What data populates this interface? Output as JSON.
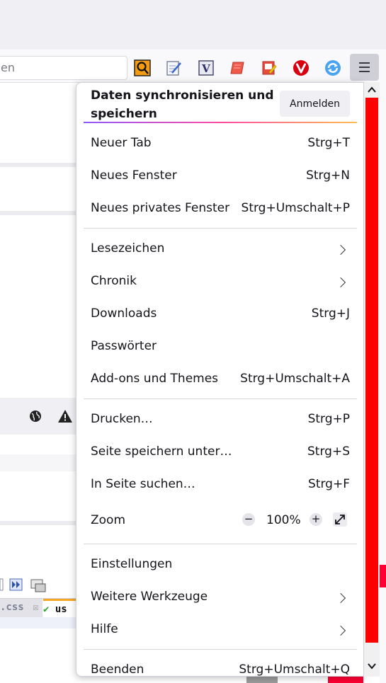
{
  "browser": {
    "url_fragment": "en",
    "toolbar_icons": [
      "search-extension-icon",
      "notepad-extension-icon",
      "v-extension-icon",
      "scroll-extension-icon",
      "edit-extension-icon",
      "vivaldi-extension-icon",
      "sync-extension-icon"
    ],
    "menu_button_icon": "hamburger-menu-icon",
    "background_tabs": [
      ".css",
      "us"
    ]
  },
  "menu": {
    "sync": {
      "title": "Daten synchronisieren und speichern",
      "signin_label": "Anmelden"
    },
    "items": [
      {
        "label": "Neuer Tab",
        "shortcut": "Strg+T"
      },
      {
        "label": "Neues Fenster",
        "shortcut": "Strg+N"
      },
      {
        "label": "Neues privates Fenster",
        "shortcut": "Strg+Umschalt+P"
      },
      {
        "label": "Lesezeichen",
        "submenu": true
      },
      {
        "label": "Chronik",
        "submenu": true
      },
      {
        "label": "Downloads",
        "shortcut": "Strg+J"
      },
      {
        "label": "Passwörter"
      },
      {
        "label": "Add-ons und Themes",
        "shortcut": "Strg+Umschalt+A"
      },
      {
        "label": "Drucken…",
        "shortcut": "Strg+P"
      },
      {
        "label": "Seite speichern unter…",
        "shortcut": "Strg+S"
      },
      {
        "label": "In Seite suchen…",
        "shortcut": "Strg+F"
      },
      {
        "label": "Zoom"
      },
      {
        "label": "Einstellungen"
      },
      {
        "label": "Weitere Werkzeuge",
        "submenu": true
      },
      {
        "label": "Hilfe",
        "submenu": true
      },
      {
        "label": "Beenden",
        "shortcut": "Strg+Umschalt+Q"
      }
    ],
    "zoom": {
      "decrease_symbol": "−",
      "level": "100%",
      "increase_symbol": "+"
    }
  },
  "colors": {
    "scrollbar_thumb": "#ff0000",
    "sync_gradient": [
      "#9059ff",
      "#ff4aa2",
      "#ffbd4f"
    ],
    "menu_button_active": "#cfcfd8"
  }
}
